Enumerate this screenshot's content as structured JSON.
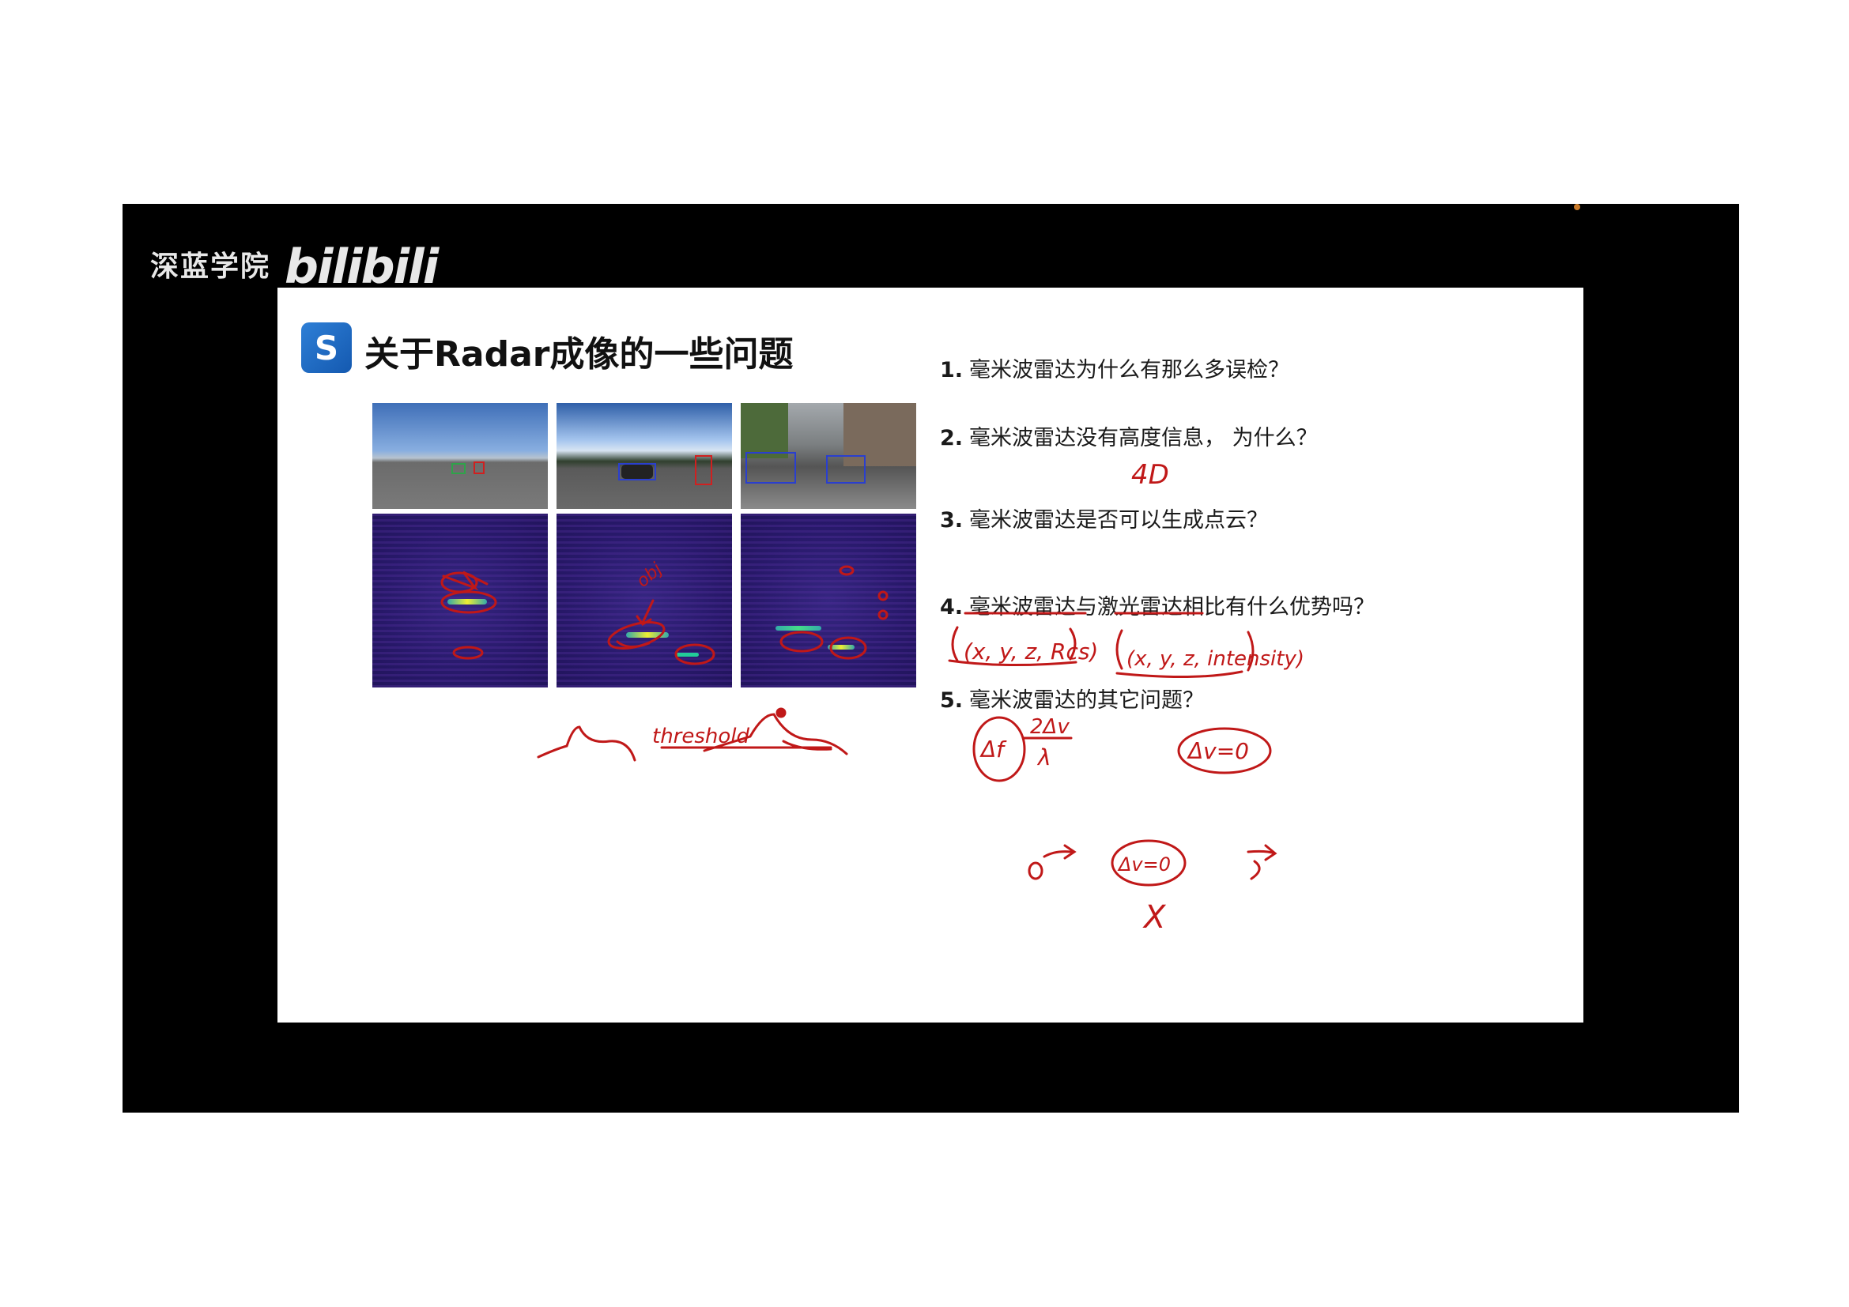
{
  "watermark": {
    "brand_cn": "深蓝学院",
    "platform": "bilibili"
  },
  "slide": {
    "logo_glyph": "S",
    "title": "关于Radar成像的一些问题",
    "questions": [
      {
        "num": "1.",
        "text": "毫米波雷达为什么有那么多误检？"
      },
      {
        "num": "2.",
        "text": "毫米波雷达没有高度信息，  为什么？"
      },
      {
        "num": "3.",
        "text": "毫米波雷达是否可以生成点云？"
      },
      {
        "num": "4.",
        "text": "毫米波雷达与激光雷达相比有什么优势吗？"
      },
      {
        "num": "5.",
        "text": "毫米波雷达的其它问题？"
      }
    ]
  },
  "annotations": {
    "q2_note": "4D",
    "radar_tuple": "(x, y, z, Rcs)",
    "lidar_tuple": "(x, y, z, intensity)",
    "heatmap_note": "obj",
    "threshold": "threshold",
    "circle_left": "Δf",
    "fraction_num": "2Δv",
    "fraction_den": "λ",
    "circle_right": "Δv=0",
    "circle_bottom": "Δv=0",
    "mark_x": "X"
  },
  "colors": {
    "ink": "#c01818",
    "frame": "#000000",
    "slide_bg": "#ffffff",
    "logo": "#1a66c2"
  }
}
